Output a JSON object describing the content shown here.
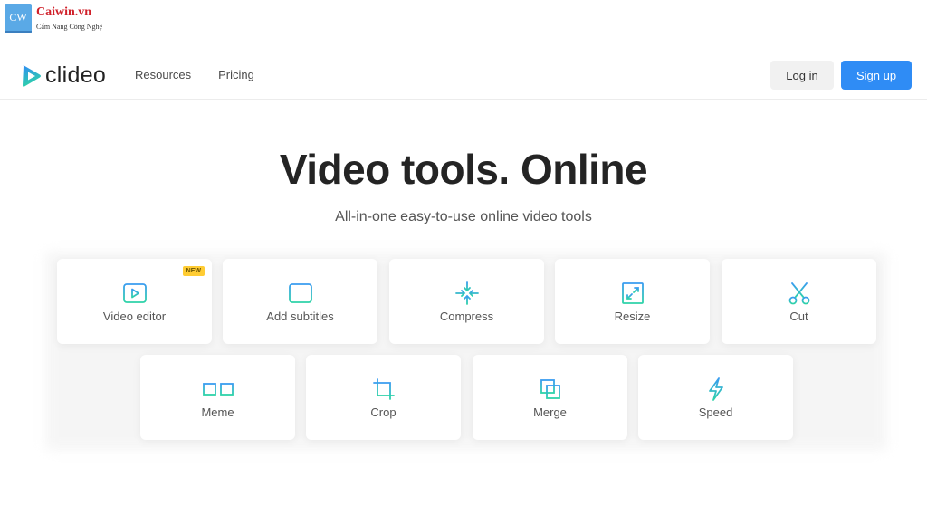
{
  "watermark": {
    "logo": "CW",
    "title": "Caiwin.vn",
    "subtitle": "Cẩm Nang Công Nghệ"
  },
  "header": {
    "brand": "clideo",
    "nav": [
      {
        "label": "Resources"
      },
      {
        "label": "Pricing"
      }
    ],
    "login_label": "Log in",
    "signup_label": "Sign up"
  },
  "hero": {
    "title": "Video tools. Online",
    "subtitle": "All-in-one easy-to-use online video tools"
  },
  "tools": [
    {
      "label": "Video editor",
      "icon": "video-editor-icon",
      "badge": "NEW"
    },
    {
      "label": "Add subtitles",
      "icon": "subtitles-icon"
    },
    {
      "label": "Compress",
      "icon": "compress-icon"
    },
    {
      "label": "Resize",
      "icon": "resize-icon"
    },
    {
      "label": "Cut",
      "icon": "scissors-icon"
    },
    {
      "label": "Meme",
      "icon": "glasses-icon"
    },
    {
      "label": "Crop",
      "icon": "crop-icon"
    },
    {
      "label": "Merge",
      "icon": "merge-icon"
    },
    {
      "label": "Speed",
      "icon": "lightning-icon"
    }
  ],
  "colors": {
    "accent": "#2f8cf5",
    "icon_top": "#3a9cf0",
    "icon_bottom": "#2ed3a8",
    "badge": "#ffcc33"
  }
}
